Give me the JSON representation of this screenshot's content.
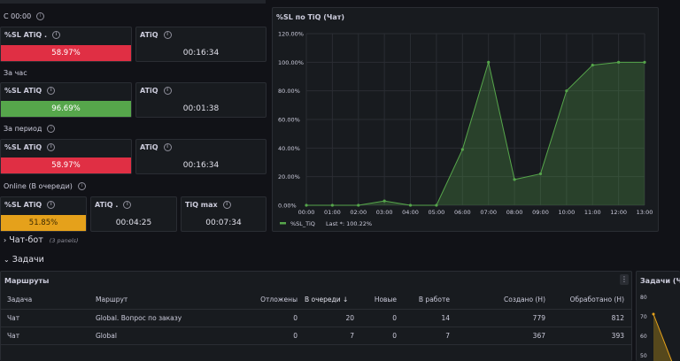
{
  "top_left": {
    "section1": {
      "label": "С 00:00"
    },
    "sl1": {
      "title": "%SL ATiQ .",
      "value": "58.97%",
      "color": "#e02f44"
    },
    "atiq1": {
      "title": "ATiQ",
      "value": "00:16:34"
    },
    "section2": {
      "label": "За час"
    },
    "sl2": {
      "title": "%SL ATiQ",
      "value": "96.69%",
      "color": "#56a64b"
    },
    "atiq2": {
      "title": "ATiQ",
      "value": "00:01:38"
    },
    "section3": {
      "label": "За период"
    },
    "sl3": {
      "title": "%SL ATiQ",
      "value": "58.97%",
      "color": "#e02f44"
    },
    "atiq3": {
      "title": "ATiQ",
      "value": "00:16:34"
    },
    "section4": {
      "label": "Online (В очереди)"
    },
    "sl4": {
      "title": "%SL ATiQ",
      "value": "51.85%",
      "color": "#e5a11b"
    },
    "atiq4": {
      "title": "ATiQ .",
      "value": "00:04:25"
    },
    "tiqmax": {
      "title": "TiQ max",
      "value": "00:07:34"
    }
  },
  "chart_panel": {
    "title": "%SL по TiQ (Чат)"
  },
  "chart_data": {
    "type": "area",
    "title": "%SL по TiQ (Чат)",
    "x": [
      "00:00",
      "01:00",
      "02:00",
      "03:00",
      "04:00",
      "05:00",
      "06:00",
      "07:00",
      "08:00",
      "09:00",
      "10:00",
      "11:00",
      "12:00",
      "13:00"
    ],
    "y_ticks": [
      "0.00%",
      "20.00%",
      "40.00%",
      "60.00%",
      "80.00%",
      "100.00%",
      "120.00%"
    ],
    "ylim": [
      0,
      120
    ],
    "series": [
      {
        "name": "%SL_TiQ",
        "values": [
          0,
          0,
          0,
          3,
          0,
          0,
          39,
          100,
          18,
          22,
          80,
          98,
          100,
          100
        ],
        "color": "#56a64b"
      }
    ],
    "legend": {
      "name": "%SL_TiQ",
      "last": "Last *: 100.22%"
    },
    "grid": true
  },
  "rows": {
    "chatbot": {
      "label": "Чат-бот",
      "count": "(3 panels)"
    },
    "tasks": {
      "label": "Задачи"
    }
  },
  "routes": {
    "title": "Маршруты",
    "menu_icon": "kebab-icon",
    "headers": [
      "Задача",
      "Маршрут",
      "Отложены",
      "В очереди ↓",
      "Новые",
      "В работе",
      "Создано (Н)",
      "Обработано (Н)"
    ],
    "rows": [
      [
        "Чат",
        "Global. Вопрос по заказу",
        "0",
        "20",
        "0",
        "14",
        "779",
        "812"
      ],
      [
        "Чат",
        "Global",
        "0",
        "7",
        "0",
        "7",
        "367",
        "393"
      ]
    ]
  },
  "right_panel": {
    "title": "Задачи (Чат",
    "y_ticks": [
      "80",
      "70",
      "60",
      "50"
    ]
  }
}
